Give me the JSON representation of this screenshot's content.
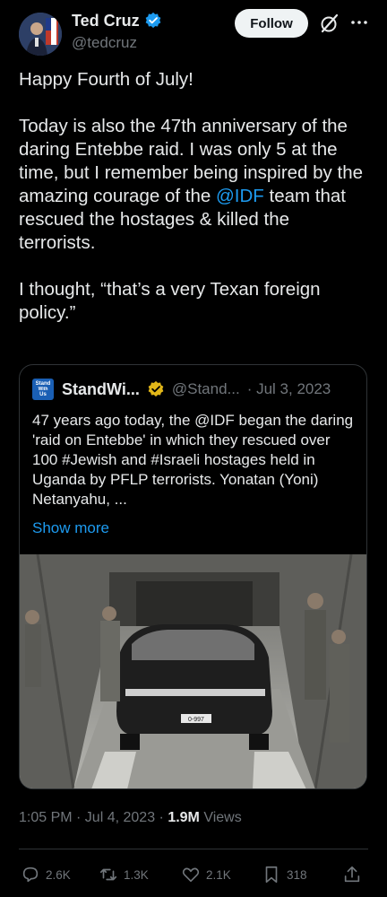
{
  "author": {
    "name": "Ted Cruz",
    "handle": "@tedcruz"
  },
  "header": {
    "follow_label": "Follow"
  },
  "tweet": {
    "line1": "Happy Fourth of July!",
    "para2_before": "Today is also the 47th anniversary of the daring Entebbe raid. I was only 5 at the time, but I remember being inspired by the amazing courage of the ",
    "para2_mention": "@IDF",
    "para2_after": " team that rescued the hostages & killed the terrorists.",
    "para3": "I thought, “that’s a very Texan foreign policy.”"
  },
  "quote": {
    "avatar_text_top": "Stand",
    "avatar_text_mid": "With",
    "avatar_text_bottom": "Us",
    "name": "StandWi...",
    "handle": "@Stand...",
    "date": "· Jul 3, 2023",
    "text": "47 years ago today, the @IDF began the daring 'raid on Entebbe' in which they rescued over 100 #Jewish and #Israeli hostages held in Uganda by PFLP terrorists. Yonatan (Yoni) Netanyahu, ...",
    "show_more": "Show more",
    "plate_text": "0-997"
  },
  "meta": {
    "time_date": "1:05 PM · Jul 4, 2023 · ",
    "views_count": "1.9M",
    "views_label": " Views"
  },
  "actions": {
    "replies": "2.6K",
    "reposts": "1.3K",
    "likes": "2.1K",
    "bookmarks": "318"
  },
  "colors": {
    "background": "#000000",
    "text": "#e7e9ea",
    "secondary": "#71767b",
    "accent": "#1d9bf0",
    "gold_badge": "#e2b719"
  }
}
